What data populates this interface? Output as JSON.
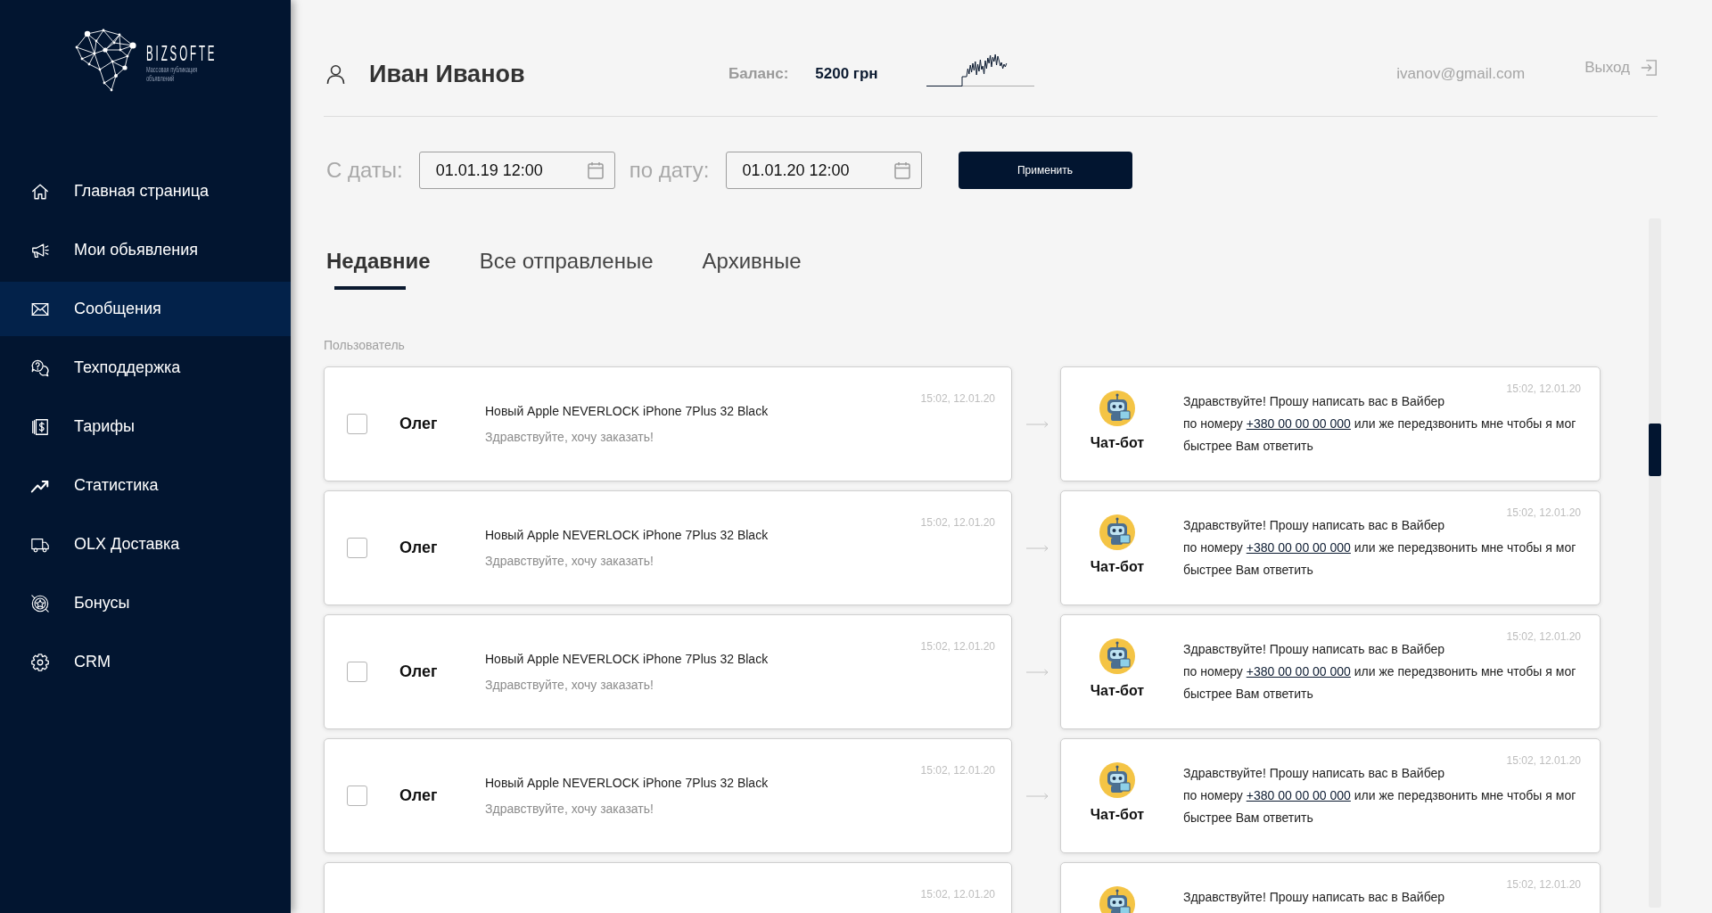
{
  "sidebar": {
    "logo": {
      "name": "BIZSOFTE",
      "tagline": "Массовая публикация объявлений"
    },
    "items": [
      {
        "label": "Главная страница",
        "selected": false
      },
      {
        "label": "Мои обьявления",
        "selected": false
      },
      {
        "label": "Сообщения",
        "selected": true
      },
      {
        "label": "Техподдержка",
        "selected": false
      },
      {
        "label": "Тарифы",
        "selected": false
      },
      {
        "label": "Статистика",
        "selected": false
      },
      {
        "label": "OLX Доставка",
        "selected": false
      },
      {
        "label": "Бонусы",
        "selected": false
      },
      {
        "label": "CRM",
        "selected": false
      }
    ]
  },
  "header": {
    "user_name": "Иван Иванов",
    "balance_label": "Баланс:",
    "balance": "5200 грн",
    "email": "ivanov@gmail.com",
    "logout": "Выход"
  },
  "date_filter": {
    "from_label": "С даты:",
    "from_value": "01.01.19 12:00",
    "to_label": "по дату:",
    "to_value": "01.01.20 12:00",
    "apply_button": "Применить"
  },
  "tabs": [
    {
      "label": "Недавние",
      "selected": true
    },
    {
      "label": "Все отправленые",
      "selected": false
    },
    {
      "label": "Архивные",
      "selected": false
    }
  ],
  "list_label": "Пользователь",
  "messages": [
    {
      "checked": false,
      "user": "Олег",
      "title": "Новый Apple NEVERLOCK iPhone 7Plus 32 Black",
      "preview": "Здравствуйте, хочу заказать!",
      "time": "15:02, 12.01.20",
      "reply": {
        "sender": "Чат-бот",
        "greeting": "Здравствуйте! Прошу написать вас в Вайбер",
        "text_before_link": "по номеру",
        "link": "+380 00 00 00 000",
        "text_after_link": "или же передзвонить мне чтобы я мог быстрее Вам ответить",
        "time": "15:02, 12.01.20"
      }
    },
    {
      "checked": false,
      "user": "Олег",
      "title": "Новый Apple NEVERLOCK iPhone 7Plus 32 Black",
      "preview": "Здравствуйте, хочу заказать!",
      "time": "15:02, 12.01.20",
      "reply": {
        "sender": "Чат-бот",
        "greeting": "Здравствуйте! Прошу написать вас в Вайбер",
        "text_before_link": "по номеру",
        "link": "+380 00 00 00 000",
        "text_after_link": "или же передзвонить мне чтобы я мог быстрее Вам ответить",
        "time": "15:02, 12.01.20"
      }
    },
    {
      "checked": false,
      "user": "Олег",
      "title": "Новый Apple NEVERLOCK iPhone 7Plus 32 Black",
      "preview": "Здравствуйте, хочу заказать!",
      "time": "15:02, 12.01.20",
      "reply": {
        "sender": "Чат-бот",
        "greeting": "Здравствуйте! Прошу написать вас в Вайбер",
        "text_before_link": "по номеру",
        "link": "+380 00 00 00 000",
        "text_after_link": "или же передзвонить мне чтобы я мог быстрее Вам ответить",
        "time": "15:02, 12.01.20"
      }
    },
    {
      "checked": false,
      "user": "Олег",
      "title": "Новый Apple NEVERLOCK iPhone 7Plus 32 Black",
      "preview": "Здравствуйте, хочу заказать!",
      "time": "15:02, 12.01.20",
      "reply": {
        "sender": "Чат-бот",
        "greeting": "Здравствуйте! Прошу написать вас в Вайбер",
        "text_before_link": "по номеру",
        "link": "+380 00 00 00 000",
        "text_after_link": "или же передзвонить мне чтобы я мог быстрее Вам ответить",
        "time": "15:02, 12.01.20"
      }
    },
    {
      "time": "15:02, 12.01.20",
      "reply": {
        "greeting": "Здравствуйте! Прошу написать вас в Вайбер",
        "time": "15:02, 12.01.20"
      }
    }
  ]
}
